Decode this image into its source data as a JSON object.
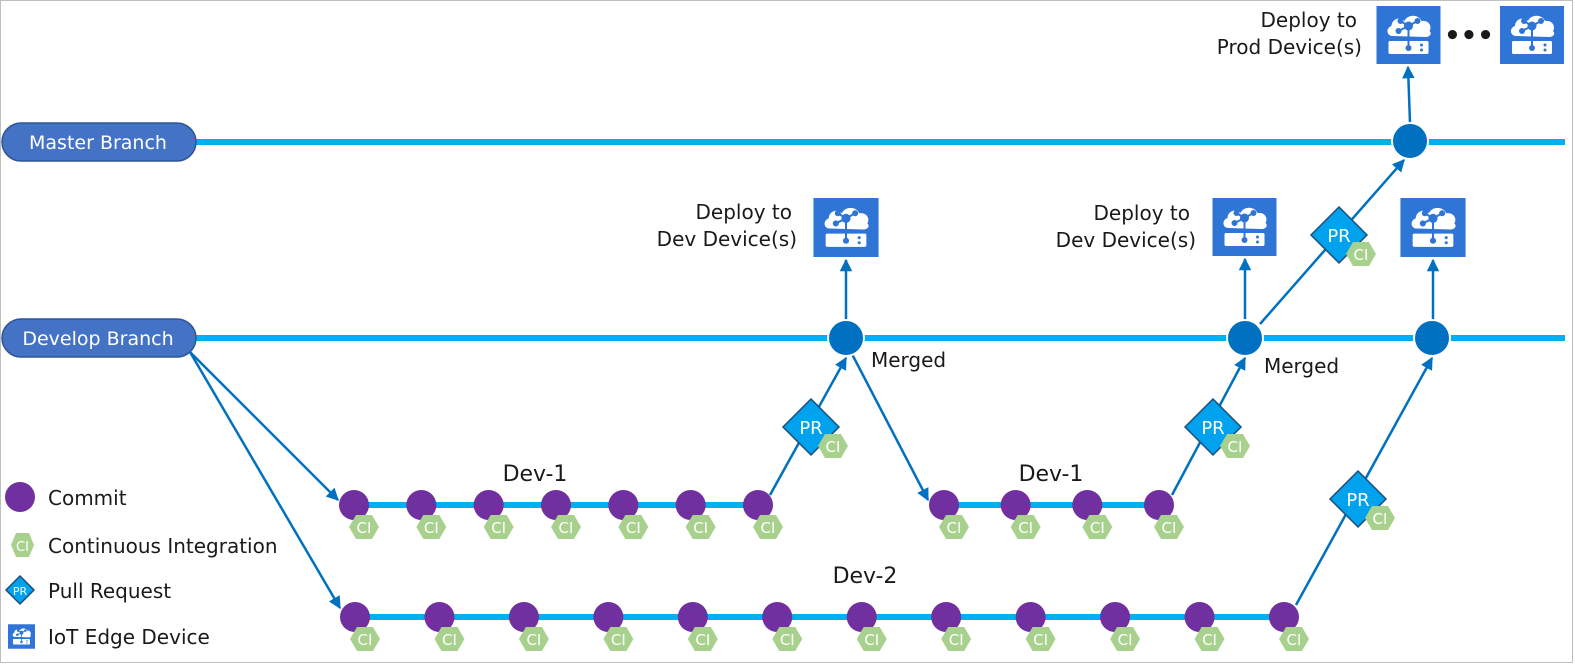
{
  "colors": {
    "branch_line": "#00b0f0",
    "arrow": "#0070c0",
    "merge_node": "#0070c0",
    "commit": "#7030a0",
    "ci": "#a9d18e",
    "pr_fill": "#00a2ed",
    "pr_stroke": "#1f4e79",
    "device": "#2e75d6",
    "pill_fill": "#4472c4",
    "pill_stroke": "#2f5597"
  },
  "branches": {
    "master": {
      "label": "Master Branch"
    },
    "develop": {
      "label": "Develop Branch"
    }
  },
  "feature_branches": {
    "dev1_first": {
      "label": "Dev-1",
      "commit_count": 7
    },
    "dev1_second": {
      "label": "Dev-1",
      "commit_count": 4
    },
    "dev2": {
      "label": "Dev-2",
      "commit_count": 12
    }
  },
  "badges": {
    "ci": "CI",
    "pr": "PR"
  },
  "annotations": {
    "merged_1": "Merged",
    "merged_2": "Merged",
    "deploy_dev_1": [
      "Deploy to",
      "Dev Device(s)"
    ],
    "deploy_dev_2": [
      "Deploy to",
      "Dev Device(s)"
    ],
    "deploy_prod": [
      "Deploy to",
      "Prod Device(s)"
    ],
    "ellipsis": "•••"
  },
  "legend": {
    "items": [
      {
        "icon": "commit-icon",
        "label": "Commit"
      },
      {
        "icon": "ci-icon",
        "label": "Continuous Integration"
      },
      {
        "icon": "pr-icon",
        "label": "Pull Request"
      },
      {
        "icon": "iot-edge-device-icon",
        "label": "IoT Edge Device"
      }
    ]
  }
}
